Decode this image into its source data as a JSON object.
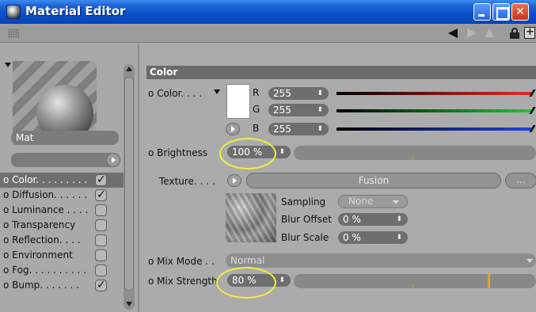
{
  "window": {
    "title": "Material Editor"
  },
  "toolbar": {
    "icons": [
      "grip-icon",
      "back-arrow-icon",
      "forward-arrow-icon",
      "up-arrow-icon",
      "lock-icon",
      "new-window-icon"
    ]
  },
  "material": {
    "name": "Mat"
  },
  "channels": [
    {
      "label": "Color",
      "dots": "o Color. . . . . . . . .",
      "checked": true,
      "selected": true
    },
    {
      "label": "Diffusion",
      "dots": "o Diffusion. . . . . .",
      "checked": true,
      "selected": false
    },
    {
      "label": "Luminance",
      "dots": "o Luminance . . . .",
      "checked": false,
      "selected": false
    },
    {
      "label": "Transparency",
      "dots": "o Transparency",
      "checked": false,
      "selected": false
    },
    {
      "label": "Reflection",
      "dots": "o Reflection. . . .",
      "checked": false,
      "selected": false
    },
    {
      "label": "Environment",
      "dots": "o Environment",
      "checked": false,
      "selected": false
    },
    {
      "label": "Fog",
      "dots": "o Fog. . . . . . . . . .",
      "checked": false,
      "selected": false
    },
    {
      "label": "Bump",
      "dots": "o Bump. . . . . . .",
      "checked": true,
      "selected": false
    }
  ],
  "section": {
    "title": "Color"
  },
  "color": {
    "label": "o Color. . . .",
    "swatch_hex": "#ffffff",
    "r_label": "R",
    "r_value": "255",
    "g_label": "G",
    "g_value": "255",
    "b_label": "B",
    "b_value": "255",
    "bar_colors": {
      "r": "#e12a2a",
      "g": "#22c43a",
      "b": "#2540e0"
    }
  },
  "brightness": {
    "label": "o Brightness",
    "value": "100 %",
    "fraction": 1.0
  },
  "texture": {
    "label": "Texture. . . .",
    "shader": "Fusion",
    "more_button": "...",
    "sampling_label": "Sampling",
    "sampling_value": "None",
    "blur_offset_label": "Blur Offset",
    "blur_offset_value": "0 %",
    "blur_scale_label": "Blur Scale",
    "blur_scale_value": "0 %"
  },
  "mix_mode": {
    "label": "o Mix Mode . .",
    "value": "Normal"
  },
  "mix_strength": {
    "label": "o Mix Strength",
    "value": "80 %",
    "fraction": 0.8
  },
  "highlight_color": "#f2ef3d"
}
